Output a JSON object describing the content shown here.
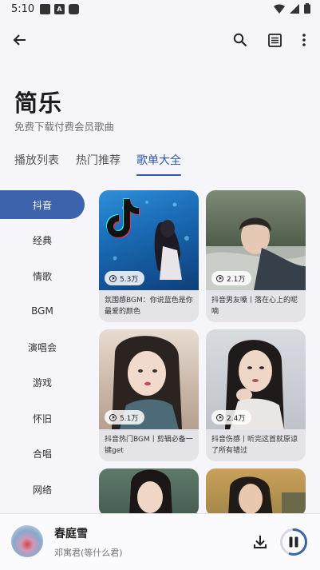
{
  "status": {
    "time": "5:10",
    "badge_letter": "A"
  },
  "app": {
    "title": "简乐",
    "subtitle": "免费下载付费会员歌曲"
  },
  "tabs": [
    {
      "label": "播放列表",
      "active": false
    },
    {
      "label": "热门推荐",
      "active": false
    },
    {
      "label": "歌单大全",
      "active": true
    }
  ],
  "categories": [
    {
      "label": "抖音",
      "active": true
    },
    {
      "label": "经典",
      "active": false
    },
    {
      "label": "情歌",
      "active": false
    },
    {
      "label": "BGM",
      "active": false
    },
    {
      "label": "演唱会",
      "active": false
    },
    {
      "label": "游戏",
      "active": false
    },
    {
      "label": "怀旧",
      "active": false
    },
    {
      "label": "合唱",
      "active": false
    },
    {
      "label": "网络",
      "active": false
    }
  ],
  "playlists": [
    {
      "plays": "5.3万",
      "title": "氛围感BGM：你说蓝色是你最爱的颜色",
      "cover": "tiktok-logo-blue-water-cover"
    },
    {
      "plays": "2.1万",
      "title": "抖音男友嗓丨落在心上的呢喃",
      "cover": "man-lying-on-pillow-cover"
    },
    {
      "plays": "5.1万",
      "title": "抖音热门BGM丨剪辑必备一键get",
      "cover": "girl-portrait-cover"
    },
    {
      "plays": "2.4万",
      "title": "抖音伤感丨听完这首就原谅了所有错过",
      "cover": "woman-hand-on-chin-cover"
    },
    {
      "plays": "",
      "title": "",
      "cover": "woman-portrait-cover"
    },
    {
      "plays": "",
      "title": "",
      "cover": "woman-sunset-cover"
    }
  ],
  "player": {
    "title": "春庭雪",
    "artist": "邓寓君(等什么君)",
    "progress": 0.55
  },
  "colors": {
    "accent": "#3d63ad",
    "tab_active": "#2e5aa8",
    "background": "#f6f5f9"
  },
  "icons": {
    "app_bar": [
      "back-arrow-icon",
      "search-icon",
      "list-icon",
      "more-vert-icon"
    ],
    "status": [
      "wifi-icon",
      "signal-icon",
      "battery-icon"
    ],
    "player": [
      "download-icon",
      "pause-icon"
    ]
  }
}
